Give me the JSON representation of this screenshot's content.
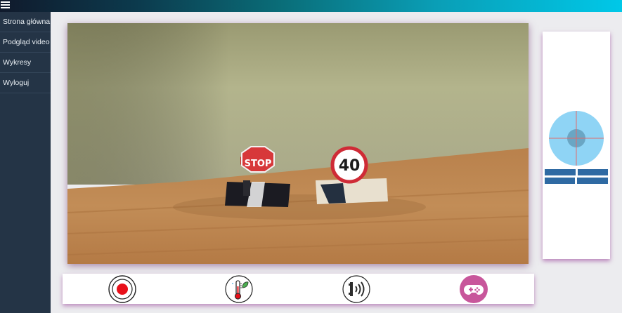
{
  "app": {
    "accent_gradient": [
      "#101a2c",
      "#0a9eb6",
      "#00c8e8"
    ],
    "sidebar_color": "#243446"
  },
  "sidebar": {
    "items": [
      {
        "label": "Strona główna"
      },
      {
        "label": "Podgląd video"
      },
      {
        "label": "Wykresy"
      },
      {
        "label": "Wyloguj"
      }
    ]
  },
  "video": {
    "signs": [
      {
        "type": "stop-sign",
        "text": "STOP"
      },
      {
        "type": "speed-limit-sign",
        "text": "40"
      }
    ]
  },
  "controls": {
    "joystick_colors": {
      "outer": "#8fd4f5",
      "inner": "#6aa6c4",
      "bars": "#2f6aa3"
    }
  },
  "toolbar": {
    "buttons": [
      {
        "name": "record-icon",
        "color": "#e8101a"
      },
      {
        "name": "thermometer-icon",
        "color": "#2d2d2d"
      },
      {
        "name": "sensor-icon",
        "color": "#2d2d2d"
      },
      {
        "name": "gamepad-icon",
        "color": "#c8569b"
      }
    ]
  }
}
